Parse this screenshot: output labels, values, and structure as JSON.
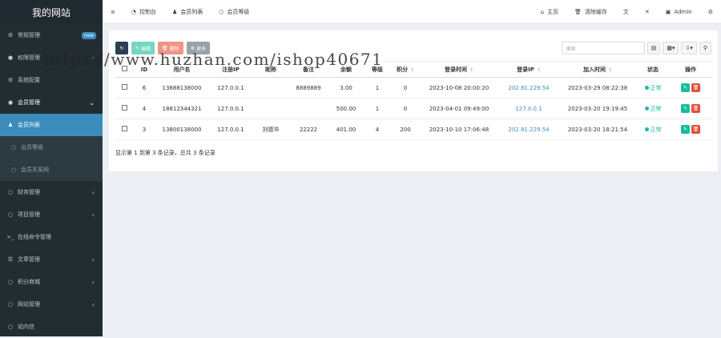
{
  "app": {
    "title": "我的网站"
  },
  "sidebar": {
    "items": [
      {
        "label": "常规管理",
        "icon": "cogs-icon",
        "badge": "new"
      },
      {
        "label": "权限管理",
        "icon": "users-icon",
        "arrow": "‹"
      },
      {
        "label": "系统配置",
        "icon": "gear-icon"
      },
      {
        "label": "会员管理",
        "icon": "user-circle-icon",
        "arrow": "⌄"
      },
      {
        "label": "会员列表",
        "icon": "user-icon"
      },
      {
        "label": "会员等级",
        "icon": "circle-icon"
      },
      {
        "label": "会员关系网",
        "icon": "circle-icon"
      },
      {
        "label": "财务管理",
        "icon": "circle-icon",
        "arrow": "‹"
      },
      {
        "label": "项目管理",
        "icon": "circle-icon",
        "arrow": "‹"
      },
      {
        "label": "在线命令管理",
        "icon": "terminal-icon"
      },
      {
        "label": "文章管理",
        "icon": "list-icon",
        "arrow": "‹"
      },
      {
        "label": "积分商城",
        "icon": "circle-icon",
        "arrow": "‹"
      },
      {
        "label": "网站管理",
        "icon": "circle-icon",
        "arrow": "‹"
      },
      {
        "label": "站内信",
        "icon": "circle-icon"
      }
    ]
  },
  "topbar": {
    "menu_icon": "≡",
    "tabs": [
      "控制台",
      "会员列表",
      "会员等级"
    ],
    "home": "主页",
    "clear_cache": "清除缓存",
    "user": "Admin"
  },
  "toolbar": {
    "edit": "编辑",
    "delete": "删除",
    "more": "更多",
    "search_placeholder": "搜索"
  },
  "table": {
    "headers": [
      "",
      "ID",
      "用户名",
      "注册IP",
      "昵称",
      "备注",
      "余额",
      "等级",
      "积分",
      "登录时间",
      "登录IP",
      "加入时间",
      "状态",
      "操作"
    ],
    "rows": [
      {
        "id": "6",
        "username": "13888138000",
        "reg_ip": "127.0.0.1",
        "nickname": "",
        "remark": "8889889",
        "balance": "3.00",
        "level": "1",
        "score": "0",
        "login_time": "2023-10-08 20:00:20",
        "login_ip": "202.81.229.54",
        "join_time": "2023-03-29 08:22:38",
        "status": "正常"
      },
      {
        "id": "4",
        "username": "18812344321",
        "reg_ip": "127.0.0.1",
        "nickname": "",
        "remark": "",
        "balance": "500.00",
        "level": "1",
        "score": "0",
        "login_time": "2023-04-01 09:49:00",
        "login_ip": "127.0.0.1",
        "join_time": "2023-03-20 19:19:45",
        "status": "正常"
      },
      {
        "id": "3",
        "username": "13800138000",
        "reg_ip": "127.0.0.1",
        "nickname": "刘德华",
        "remark": "22222",
        "balance": "401.00",
        "level": "4",
        "score": "200",
        "login_time": "2023-10-10 17:06:48",
        "login_ip": "202.81.229.54",
        "join_time": "2023-03-20 18:21:54",
        "status": "正常"
      }
    ]
  },
  "footer": {
    "text": "显示第 1 到第 3 条记录，总共 3 条记录"
  },
  "watermark": "https://www.huzhan.com/ishop40671",
  "colors": {
    "sidebar_bg": "#222d32",
    "active": "#3c8dbc",
    "success": "#18bc9c",
    "danger": "#e74c3c"
  }
}
